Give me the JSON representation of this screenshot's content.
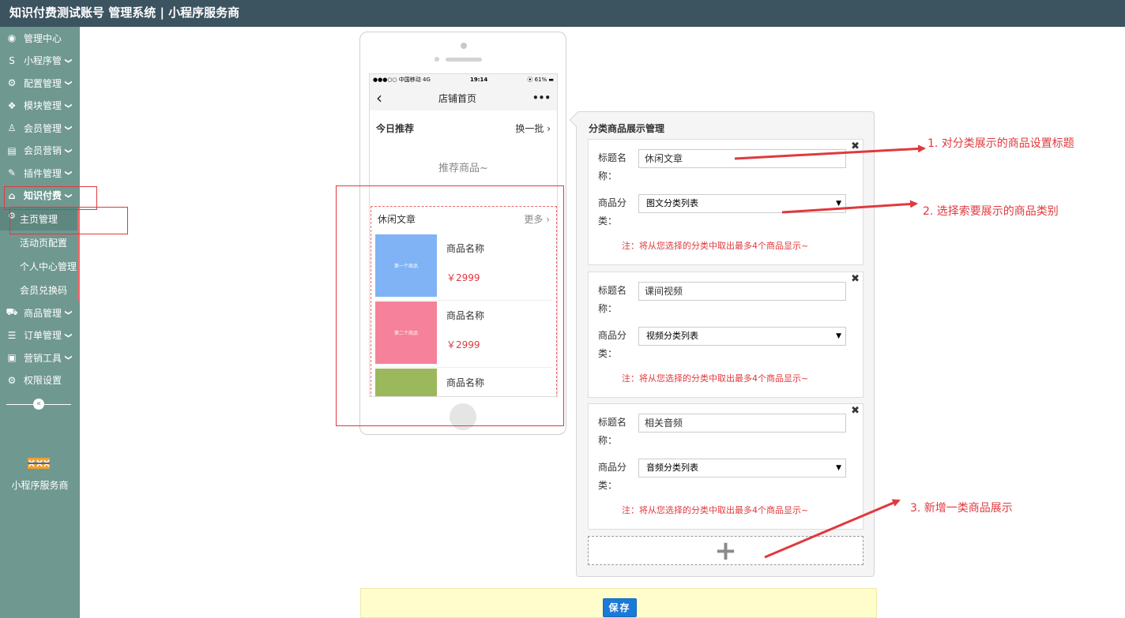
{
  "app": {
    "title": "知识付费测试账号 管理系统 | 小程序服务商"
  },
  "sidebar": {
    "items": [
      {
        "label": "管理中心",
        "icon": "dashboard-icon",
        "glyph": "◉",
        "chevron": false
      },
      {
        "label": "小程序管",
        "icon": "miniapp-s-icon",
        "glyph": "S",
        "chevron": true
      },
      {
        "label": "配置管理",
        "icon": "cogs-icon",
        "glyph": "⚙",
        "chevron": true
      },
      {
        "label": "模块管理",
        "icon": "cubes-icon",
        "glyph": "❖",
        "chevron": true
      },
      {
        "label": "会员管理",
        "icon": "user-icon",
        "glyph": "♙",
        "chevron": true
      },
      {
        "label": "会员营销",
        "icon": "id-card-icon",
        "glyph": "▤",
        "chevron": true
      },
      {
        "label": "插件管理",
        "icon": "plug-icon",
        "glyph": "✎",
        "chevron": true
      },
      {
        "label": "知识付费",
        "icon": "home-icon",
        "glyph": "⌂",
        "chevron": true,
        "active": true
      }
    ],
    "sub_items": [
      {
        "label": "主页管理",
        "current": true
      },
      {
        "label": "活动页配置"
      },
      {
        "label": "个人中心管理"
      },
      {
        "label": "会员兑换码"
      }
    ],
    "items_after": [
      {
        "label": "商品管理",
        "icon": "cart-icon",
        "glyph": "⛟",
        "chevron": true
      },
      {
        "label": "订单管理",
        "icon": "list-icon",
        "glyph": "☰",
        "chevron": true
      },
      {
        "label": "营销工具",
        "icon": "briefcase-icon",
        "glyph": "▣",
        "chevron": true
      },
      {
        "label": "权限设置",
        "icon": "gear-icon",
        "glyph": "⚙",
        "chevron": false
      }
    ],
    "collapse_glyph": "«",
    "brand": "小程序服务商"
  },
  "phone": {
    "status": {
      "carrier": "●●●○○ 中国移动  4G",
      "time": "19:14",
      "battery": "⦿ 61% ▬"
    },
    "nav": {
      "back": "‹",
      "title": "店铺首页",
      "menu": "•••"
    },
    "recommend": {
      "title": "今日推荐",
      "more": "换一批 ›",
      "placeholder": "推荐商品~"
    },
    "category": {
      "title": "休闲文章",
      "more": "更多 ›"
    },
    "goods": [
      {
        "thumb_label": "第一个商品",
        "thumb_color": "#7fb3f5",
        "name": "商品名称",
        "price": "￥2999"
      },
      {
        "thumb_label": "第二个商品",
        "thumb_color": "#f5829a",
        "name": "商品名称",
        "price": "￥2999"
      },
      {
        "thumb_label": "",
        "thumb_color": "#9cb85c",
        "name": "商品名称",
        "price": ""
      }
    ]
  },
  "panel": {
    "title": "分类商品展示管理",
    "title_label": "标题名称：",
    "category_label": "商品分类：",
    "note": "注：将从您选择的分类中取出最多4个商品显示~",
    "close_glyph": "✖",
    "add_glyph": "+",
    "sections": [
      {
        "title_value": "休闲文章",
        "category_value": "图文分类列表"
      },
      {
        "title_value": "课间视频",
        "category_value": "视频分类列表"
      },
      {
        "title_value": "相关音频",
        "category_value": "音频分类列表"
      }
    ]
  },
  "save_label": "保存",
  "annotations": [
    {
      "text": "1. 对分类展示的商品设置标题"
    },
    {
      "text": "2. 选择索要展示的商品类别"
    },
    {
      "text": "3. 新增一类商品展示"
    }
  ],
  "colors": {
    "topbar": "#3c5360",
    "sidebar": "#6f9890",
    "accent_red": "#e0393e",
    "save_button": "#1a7ad8"
  }
}
